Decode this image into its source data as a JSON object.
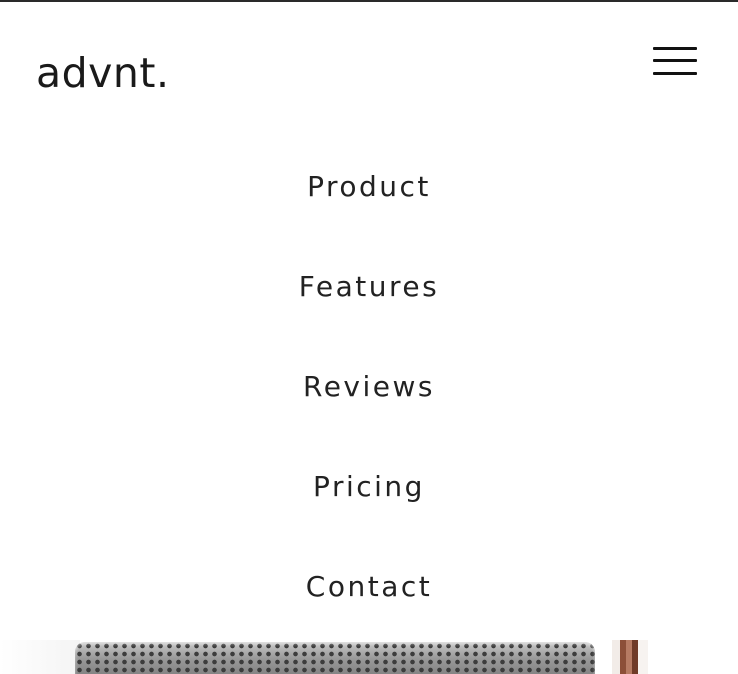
{
  "header": {
    "logo_text": "advnt.",
    "menu_toggle_icon": "hamburger-menu-icon"
  },
  "nav": {
    "items": [
      {
        "label": "Product"
      },
      {
        "label": "Features"
      },
      {
        "label": "Reviews"
      },
      {
        "label": "Pricing"
      },
      {
        "label": "Contact"
      }
    ]
  },
  "colors": {
    "background": "#ffffff",
    "text": "#222222",
    "topline": "#2a2a2a"
  }
}
